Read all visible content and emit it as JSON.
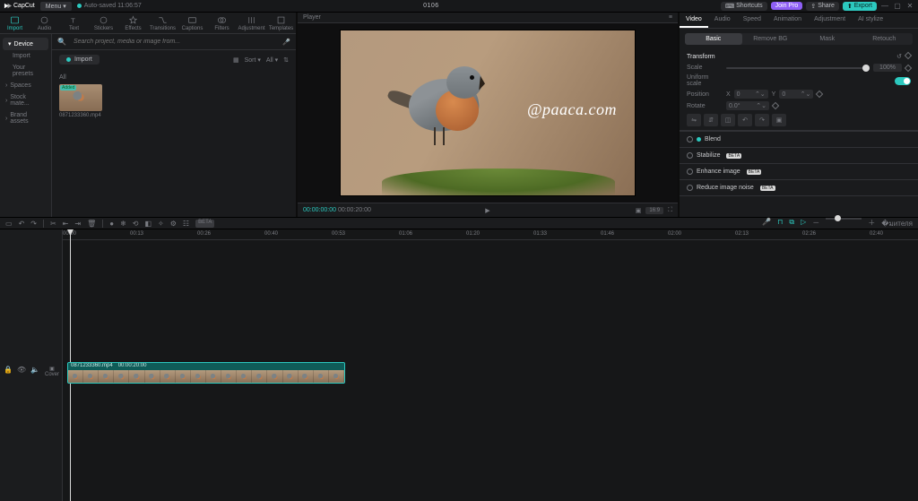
{
  "titlebar": {
    "app": "CapCut",
    "menu": "Menu",
    "autosave": "Auto-saved 11:06:57",
    "project": "0106",
    "shortcuts": "Shortcuts",
    "joinpro": "Join Pro",
    "share": "Share",
    "export": "Export"
  },
  "tooltabs": {
    "import": "Import",
    "audio": "Audio",
    "text": "Text",
    "stickers": "Stickers",
    "effects": "Effects",
    "transitions": "Transitions",
    "captions": "Captions",
    "filters": "Filters",
    "adjustment": "Adjustment",
    "templates": "Templates"
  },
  "mediaside": {
    "device": "Device",
    "import": "Import",
    "presets": "Your presets",
    "spaces": "Spaces",
    "stock": "Stock mate...",
    "brand": "Brand assets"
  },
  "media": {
    "searchPlaceholder": "Search project, media or image from...",
    "importBtn": "Import",
    "sort": "Sort",
    "all": "All",
    "tabAll": "All",
    "added": "Added",
    "clipName": "0871233360.mp4"
  },
  "player": {
    "title": "Player",
    "watermark": "@paaca.com",
    "cur": "00:00:00:00",
    "dur": "00:00:20:00",
    "ratio": "16:9"
  },
  "inspector": {
    "tabs": {
      "video": "Video",
      "audio": "Audio",
      "speed": "Speed",
      "animation": "Animation",
      "adjustment": "Adjustment",
      "ai": "AI stylize"
    },
    "sub": {
      "basic": "Basic",
      "removebg": "Remove BG",
      "mask": "Mask",
      "retouch": "Retouch"
    },
    "transform": "Transform",
    "scale": "Scale",
    "scaleVal": "100%",
    "uniform": "Uniform scale",
    "position": "Position",
    "pxX": "X",
    "pxY": "Y",
    "pxV": "0",
    "rotate": "Rotate",
    "rotVal": "0.0°",
    "blend": "Blend",
    "stabilize": "Stabilize",
    "enhance": "Enhance image",
    "noise": "Reduce image noise",
    "beta": "BETA"
  },
  "timeline": {
    "ticks": [
      "00:00",
      "00:13",
      "00:26",
      "00:40",
      "00:53",
      "01:06",
      "01:20",
      "01:33",
      "01:46",
      "02:00",
      "02:13",
      "02:26",
      "02:40"
    ],
    "clipName": "0871233360.mp4",
    "clipDur": "00:00:20:00",
    "cover": "Cover"
  }
}
